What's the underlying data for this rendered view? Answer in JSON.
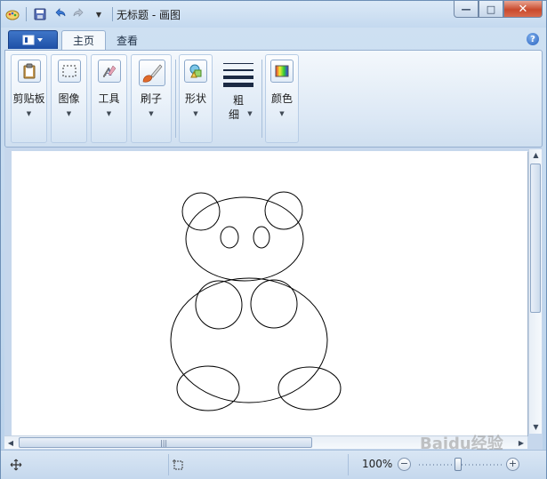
{
  "window": {
    "title": "无标题 - 画图",
    "minimize_label": "—",
    "maximize_label": "□",
    "close_label": "✕"
  },
  "tabs": [
    {
      "label": "主页",
      "active": true
    },
    {
      "label": "查看",
      "active": false
    }
  ],
  "help_label": "?",
  "ribbon": {
    "groups": [
      {
        "label": "剪贴板",
        "icon": "clipboard-icon"
      },
      {
        "label": "图像",
        "icon": "select-icon"
      },
      {
        "label": "工具",
        "icon": "tools-icon"
      },
      {
        "label": "刷子",
        "icon": "brush-icon"
      },
      {
        "label": "形状",
        "icon": "shapes-icon"
      },
      {
        "label_line1": "粗",
        "label_line2": "细",
        "icon": "line-width-icon"
      },
      {
        "label": "颜色",
        "icon": "colors-icon"
      }
    ]
  },
  "status": {
    "zoom": "100%"
  },
  "watermark": "Baidu经验",
  "colors": {
    "accent": "#1d4fa6",
    "close": "#c94a2d"
  }
}
